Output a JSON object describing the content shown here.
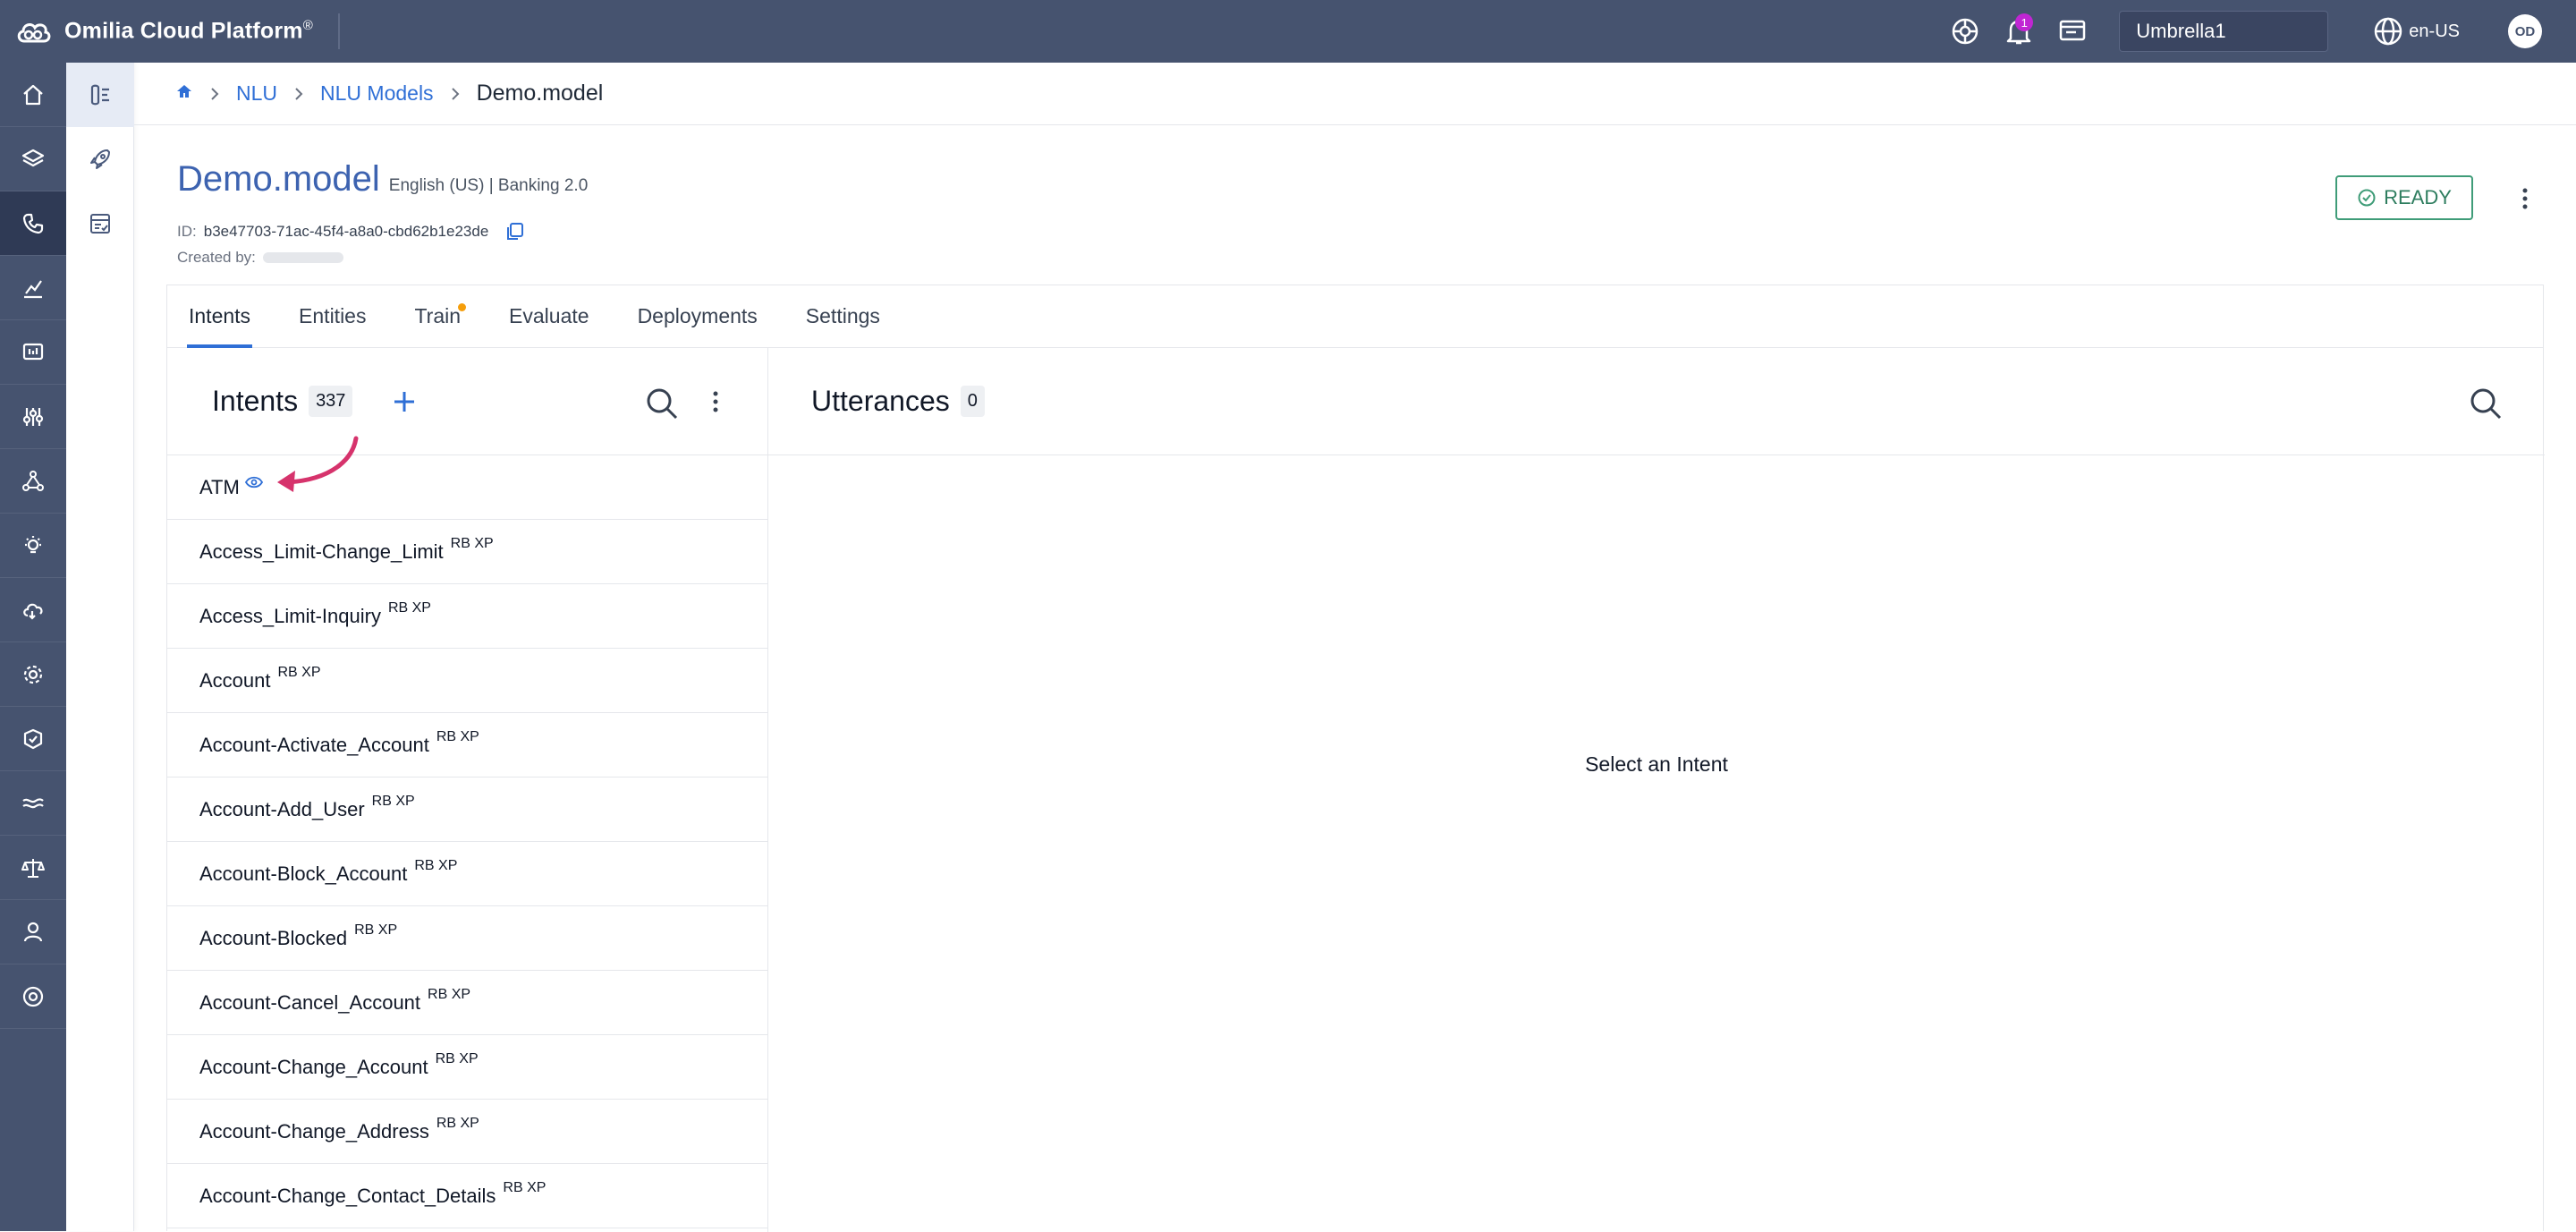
{
  "topbar": {
    "brand_name": "Omilia Cloud Platform",
    "brand_reg": "®",
    "notification_count": "1",
    "tenant": "Umbrella1",
    "locale": "en-US",
    "avatar_initials": "OD"
  },
  "rail": {
    "items": [
      "home-icon",
      "layers-icon",
      "phone-icon",
      "analytics-icon",
      "dashboard-icon",
      "sliders-icon",
      "network-icon",
      "bulb-icon",
      "cloud-icon",
      "gear-icon",
      "shield-icon",
      "speech-icon",
      "balance-icon",
      "user-icon",
      "support-icon"
    ],
    "active_index": 2
  },
  "subrail": {
    "items": [
      "nlu-icon",
      "rocket-icon",
      "report-icon"
    ],
    "active_index": 0
  },
  "breadcrumb": {
    "items": [
      "NLU",
      "NLU Models"
    ],
    "current": "Demo.model"
  },
  "model": {
    "name": "Demo.model",
    "meta": "English (US) | Banking 2.0",
    "id_label": "ID:",
    "id": "b3e47703-71ac-45f4-a8a0-cbd62b1e23de",
    "created_label": "Created by:",
    "status": "READY"
  },
  "tabs": [
    {
      "label": "Intents",
      "active": true
    },
    {
      "label": "Entities"
    },
    {
      "label": "Train",
      "dot": true
    },
    {
      "label": "Evaluate"
    },
    {
      "label": "Deployments"
    },
    {
      "label": "Settings"
    }
  ],
  "intents_panel": {
    "title": "Intents",
    "count": "337",
    "items": [
      {
        "name": "ATM",
        "tag": ""
      },
      {
        "name": "Access_Limit-Change_Limit",
        "tag": "RB XP"
      },
      {
        "name": "Access_Limit-Inquiry",
        "tag": "RB XP"
      },
      {
        "name": "Account",
        "tag": "RB XP"
      },
      {
        "name": "Account-Activate_Account",
        "tag": "RB XP"
      },
      {
        "name": "Account-Add_User",
        "tag": "RB XP"
      },
      {
        "name": "Account-Block_Account",
        "tag": "RB XP"
      },
      {
        "name": "Account-Blocked",
        "tag": "RB XP"
      },
      {
        "name": "Account-Cancel_Account",
        "tag": "RB XP"
      },
      {
        "name": "Account-Change_Account",
        "tag": "RB XP"
      },
      {
        "name": "Account-Change_Address",
        "tag": "RB XP"
      },
      {
        "name": "Account-Change_Contact_Details",
        "tag": "RB XP"
      }
    ]
  },
  "utterances_panel": {
    "title": "Utterances",
    "count": "0",
    "empty_message": "Select an Intent"
  },
  "colors": {
    "topbar": "#46536f",
    "accent": "#2f6fd6",
    "ready": "#3f9c78",
    "annotation_arrow": "#d6336c"
  }
}
